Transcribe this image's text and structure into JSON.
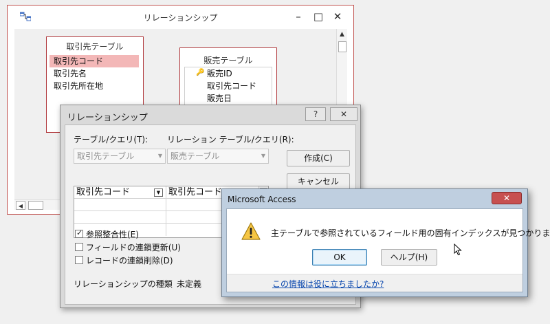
{
  "rel_window": {
    "title": "リレーションシップ",
    "controls": {
      "minimize": "–",
      "maximize": "□",
      "close": "✕"
    },
    "table_left": {
      "title": "取引先テーブル",
      "fields": [
        "取引先コード",
        "取引先名",
        "取引先所在地"
      ]
    },
    "table_right": {
      "title": "販売テーブル",
      "fields": [
        "販売ID",
        "取引先コード",
        "販売日"
      ]
    }
  },
  "edit_dialog": {
    "title": "リレーションシップ",
    "help_label": "?",
    "close_label": "✕",
    "table_label": "テーブル/クエリ(T):",
    "related_label": "リレーション テーブル/クエリ(R):",
    "table_value": "取引先テーブル",
    "related_value": "販売テーブル",
    "grid": [
      [
        "取引先コード",
        "取引先コード"
      ],
      [
        "",
        ""
      ],
      [
        "",
        ""
      ],
      [
        "",
        ""
      ]
    ],
    "create_button": "作成(C)",
    "cancel_button": "キャンセル",
    "checks": [
      {
        "label": "参照整合性(E)",
        "checked": true
      },
      {
        "label": "フィールドの連鎖更新(U)",
        "checked": false
      },
      {
        "label": "レコードの連鎖削除(D)",
        "checked": false
      }
    ],
    "type_label": "リレーションシップの種類",
    "type_value": "未定義"
  },
  "msg_box": {
    "title": "Microsoft Access",
    "close_label": "✕",
    "message": "主テーブルで参照されているフィールド用の固有インデックスが見つかりません。",
    "ok_button": "OK",
    "help_button": "ヘルプ(H)",
    "link": "この情報は役に立ちましたか?"
  },
  "colors": {
    "accent_red": "#c0504d",
    "selected_field": "#f3b7b7",
    "link": "#0645ad"
  },
  "icons": [
    "relationships-app-icon",
    "primary-key-icon",
    "warning-icon",
    "mouse-pointer-icon"
  ]
}
